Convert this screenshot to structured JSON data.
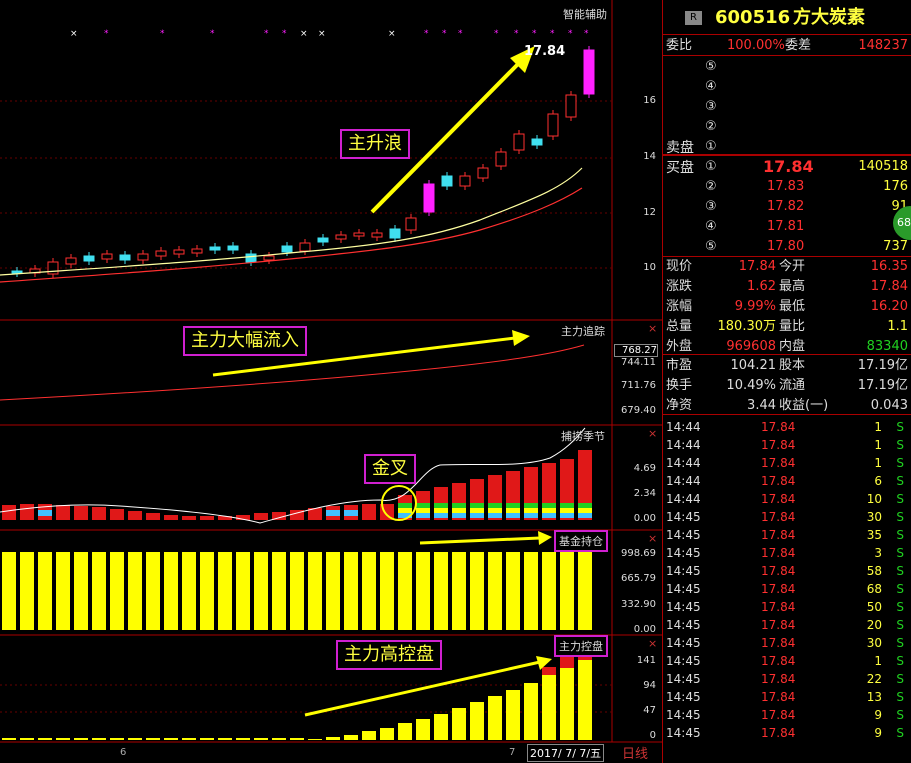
{
  "chart": {
    "top_label": "智能辅助",
    "price_ticks": [
      "16",
      "14",
      "12",
      "10"
    ],
    "last_price_tag": "17.84",
    "annotation_wave": "主升浪",
    "panel2": {
      "label": "主力追踪",
      "ticks": [
        "768.27",
        "744.11",
        "711.76",
        "679.40"
      ],
      "annotation": "主力大幅流入"
    },
    "panel3": {
      "label": "捕捞季节",
      "ticks": [
        "4.69",
        "2.34",
        "0.00"
      ],
      "annotation": "金叉"
    },
    "panel4": {
      "label": "基金持仓",
      "ticks": [
        "998.69",
        "665.79",
        "332.90",
        "0.00"
      ]
    },
    "panel5": {
      "label": "主力控盘",
      "ticks": [
        "141",
        "94",
        "47",
        "0"
      ],
      "annotation": "主力高控盘"
    },
    "x_labels": {
      "left": "6",
      "right": "7",
      "date": "2017/ 7/ 7/五",
      "line_type": "日线"
    },
    "close_mark": "×",
    "colors": {
      "up": "#ff3030",
      "down": "#40e0f0",
      "wave": "#ff20ff",
      "yellow": "#ffff00",
      "annot_border": "#d020d0"
    }
  },
  "quote": {
    "badge": "R",
    "code": "600516",
    "name": "方大炭素",
    "weibi_label": "委比",
    "weibi_value": "100.00%",
    "weicha_label": "委差",
    "weicha_value": "148237",
    "sell_label": "卖盘",
    "buy_label": "买盘",
    "sell_levels": [
      "⑤",
      "④",
      "③",
      "②",
      "①"
    ],
    "buy_levels": [
      {
        "n": "①",
        "price": "17.84",
        "vol": "140518"
      },
      {
        "n": "②",
        "price": "17.83",
        "vol": "176"
      },
      {
        "n": "③",
        "price": "17.82",
        "vol": "91"
      },
      {
        "n": "④",
        "price": "17.81",
        "vol": "4"
      },
      {
        "n": "⑤",
        "price": "17.80",
        "vol": "737"
      }
    ],
    "side_badge": "68",
    "stats": [
      {
        "l1": "现价",
        "v1": "17.84",
        "l2": "今开",
        "v2": "16.35"
      },
      {
        "l1": "涨跌",
        "v1": "1.62",
        "l2": "最高",
        "v2": "17.84"
      },
      {
        "l1": "涨幅",
        "v1": "9.99%",
        "l2": "最低",
        "v2": "16.20"
      },
      {
        "l1": "总量",
        "v1": "180.30万",
        "l2": "量比",
        "v2": "1.1"
      },
      {
        "l1": "外盘",
        "v1": "969608",
        "l2": "内盘",
        "v2": "83340"
      }
    ],
    "stats2": [
      {
        "l1": "市盈",
        "v1": "104.21",
        "l2": "股本",
        "v2": "17.19亿"
      },
      {
        "l1": "换手",
        "v1": "10.49%",
        "l2": "流通",
        "v2": "17.19亿"
      },
      {
        "l1": "净资",
        "v1": "3.44",
        "l2": "收益(一)",
        "v2": "0.043"
      }
    ],
    "ticks": [
      {
        "t": "14:44",
        "p": "17.84",
        "v": "1",
        "s": "S"
      },
      {
        "t": "14:44",
        "p": "17.84",
        "v": "1",
        "s": "S"
      },
      {
        "t": "14:44",
        "p": "17.84",
        "v": "1",
        "s": "S"
      },
      {
        "t": "14:44",
        "p": "17.84",
        "v": "6",
        "s": "S"
      },
      {
        "t": "14:44",
        "p": "17.84",
        "v": "10",
        "s": "S"
      },
      {
        "t": "14:45",
        "p": "17.84",
        "v": "30",
        "s": "S"
      },
      {
        "t": "14:45",
        "p": "17.84",
        "v": "35",
        "s": "S"
      },
      {
        "t": "14:45",
        "p": "17.84",
        "v": "3",
        "s": "S"
      },
      {
        "t": "14:45",
        "p": "17.84",
        "v": "58",
        "s": "S"
      },
      {
        "t": "14:45",
        "p": "17.84",
        "v": "68",
        "s": "S"
      },
      {
        "t": "14:45",
        "p": "17.84",
        "v": "50",
        "s": "S"
      },
      {
        "t": "14:45",
        "p": "17.84",
        "v": "20",
        "s": "S"
      },
      {
        "t": "14:45",
        "p": "17.84",
        "v": "30",
        "s": "S"
      },
      {
        "t": "14:45",
        "p": "17.84",
        "v": "1",
        "s": "S"
      },
      {
        "t": "14:45",
        "p": "17.84",
        "v": "22",
        "s": "S"
      },
      {
        "t": "14:45",
        "p": "17.84",
        "v": "13",
        "s": "S"
      },
      {
        "t": "14:45",
        "p": "17.84",
        "v": "9",
        "s": "S"
      },
      {
        "t": "14:45",
        "p": "17.84",
        "v": "9",
        "s": "S"
      }
    ]
  }
}
